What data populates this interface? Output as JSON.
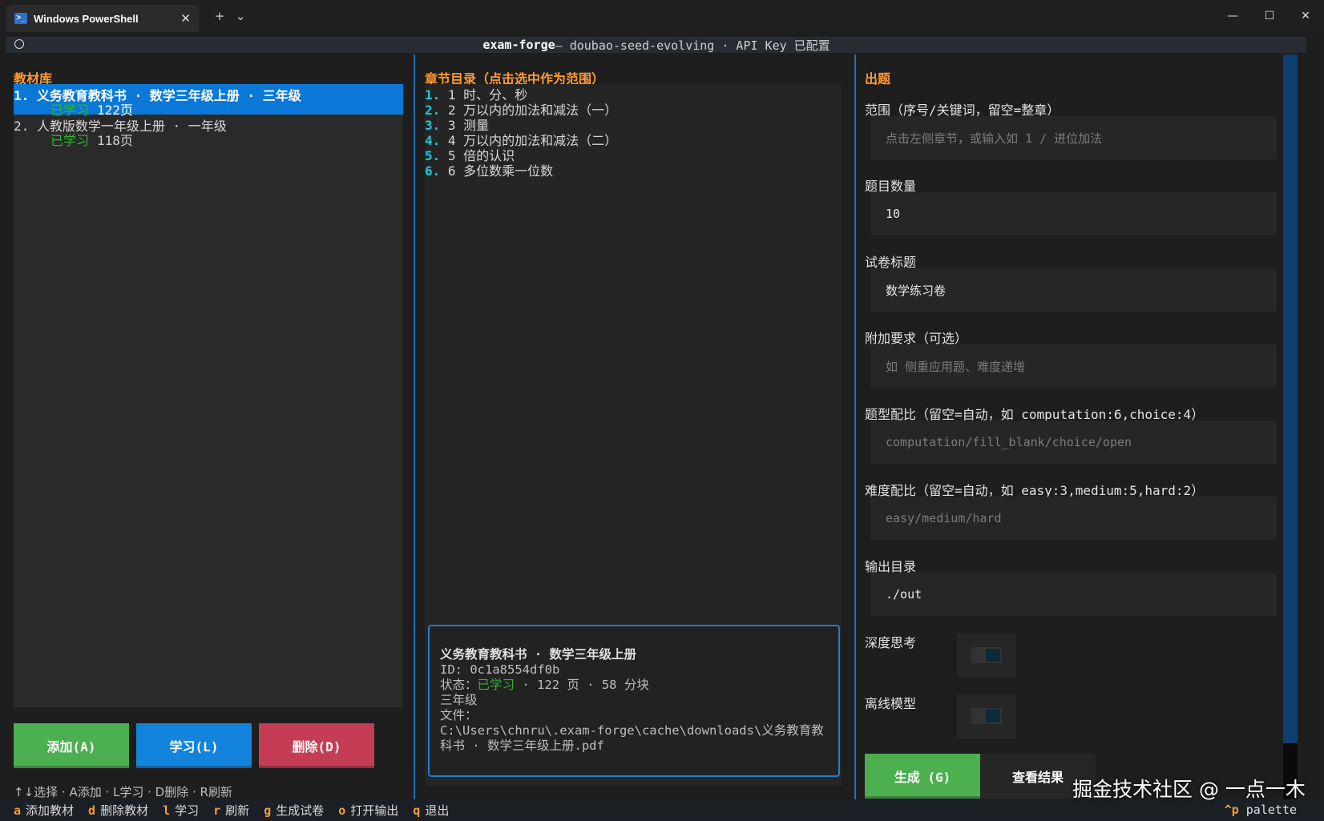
{
  "window": {
    "tab_title": "Windows PowerShell",
    "tab_close": "✕",
    "new_tab": "+",
    "dropdown": "⌄",
    "minimize": "—",
    "maximize": "☐",
    "close": "✕"
  },
  "header": {
    "app_name": "exam-forge",
    "rest": " — doubao-seed-evolving · API Key 已配置"
  },
  "library": {
    "title": "教材库",
    "books": [
      {
        "line1": "1. 义务教育教科书 · 数学三年级上册 · 三年级",
        "status": "已学习",
        "pages": "122页"
      },
      {
        "line1": "2. 人教版数学一年级上册 · 一年级",
        "status": "已学习",
        "pages": "118页"
      }
    ],
    "add_button": "添加(A)",
    "learn_button": "学习(L)",
    "delete_button": "删除(D)"
  },
  "chapters": {
    "title": "章节目录（点击选中作为范围）",
    "items": [
      {
        "num": "1.",
        "text": "1 时、分、秒"
      },
      {
        "num": "2.",
        "text": "2 万以内的加法和减法（一）"
      },
      {
        "num": "3.",
        "text": "3 测量"
      },
      {
        "num": "4.",
        "text": "4 万以内的加法和减法（二）"
      },
      {
        "num": "5.",
        "text": "5 倍的认识"
      },
      {
        "num": "6.",
        "text": "6 多位数乘一位数"
      }
    ]
  },
  "info": {
    "title": "义务教育教科书 · 数学三年级上册",
    "id_line": "ID: 0c1a8554df0b",
    "status_label": "状态：",
    "status_value": "已学习",
    "status_rest": " · 122 页 · 58 分块",
    "grade": "三年级",
    "file_label": "文件：",
    "file_path": "C:\\Users\\chnru\\.exam-forge\\cache\\downloads\\义务教育教科书 · 数学三年级上册.pdf"
  },
  "form": {
    "title": "出题",
    "scope_label": "范围（序号/关键词，留空=整章）",
    "scope_placeholder": "点击左侧章节，或输入如 1 / 进位加法",
    "count_label": "题目数量",
    "count_value": "10",
    "paper_title_label": "试卷标题",
    "paper_title_value": "数学练习卷",
    "extra_label": "附加要求（可选）",
    "extra_placeholder": "如 侧重应用题、难度递增",
    "type_ratio_label": "题型配比（留空=自动，如 computation:6,choice:4）",
    "type_ratio_placeholder": "computation/fill_blank/choice/open",
    "difficulty_label": "难度配比（留空=自动，如 easy:3,medium:5,hard:2）",
    "difficulty_placeholder": "easy/medium/hard",
    "output_label": "输出目录",
    "output_value": "./out",
    "deep_think_label": "深度思考",
    "offline_label": "离线模型",
    "generate_button": "生成 (G)",
    "view_button": "查看结果"
  },
  "hints": "↑↓选择 · A添加 · L学习 · D删除 · R刷新",
  "footer": [
    {
      "key": "a",
      "label": "添加教材"
    },
    {
      "key": "d",
      "label": "删除教材"
    },
    {
      "key": "l",
      "label": "学习"
    },
    {
      "key": "r",
      "label": "刷新"
    },
    {
      "key": "g",
      "label": "生成试卷"
    },
    {
      "key": "o",
      "label": "打开输出"
    },
    {
      "key": "q",
      "label": "退出"
    }
  ],
  "palette": {
    "key": "^p",
    "label": "palette"
  },
  "watermark": "掘金技术社区 @ 一点一木",
  "colors": {
    "accent_orange": "#ff9c2f",
    "selection_blue": "#0b78d7",
    "green": "#4caf50",
    "red": "#c43d55"
  }
}
